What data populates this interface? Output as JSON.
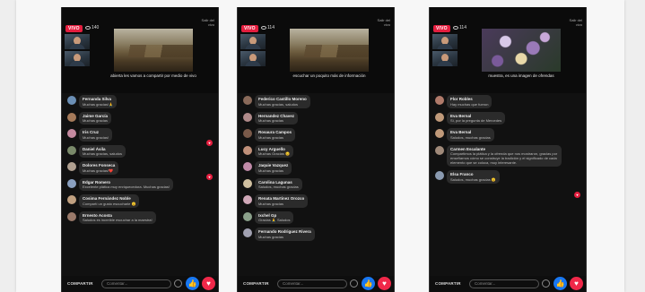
{
  "phones": [
    {
      "live": "VIVO",
      "viewers": "140",
      "close": "Salir del vivo",
      "video_style": "landscape",
      "caption": "abierta les vamos a compartir por medio de vivo",
      "share": "COMPARTIR",
      "comment_placeholder": "Comentar...",
      "comments": [
        {
          "name": "Fernanda Silva",
          "text": "Muchas gracias!🙏",
          "actions": "Me gusta · Responder",
          "avatar": "#6b8fb5"
        },
        {
          "name": "Jaime García",
          "text": "Muchas gracias",
          "actions": "Me gusta · Responder",
          "avatar": "#a57a5a"
        },
        {
          "name": "Iris Cruz",
          "text": "Muchas gracias!",
          "actions": "Me gusta · Responder",
          "avatar": "#c58aa0"
        },
        {
          "name": "Daniel Ávila",
          "text": "Muchas gracias, saludos",
          "actions": "Me gusta · Responder",
          "avatar": "#7a8a6a"
        },
        {
          "name": "Dolores Fonseca",
          "text": "Muchas gracias!❤️",
          "actions": "Me gusta · Responder",
          "avatar": "#b0a090"
        },
        {
          "name": "Edgar Romero",
          "text": "Excelente plática muy enriquecedora. Muchas gracias!",
          "actions": "Me gusta · Responder",
          "avatar": "#8aa0c0"
        },
        {
          "name": "Cosima Fernández Noble",
          "text": "Compartí un gusto escucharle 😊",
          "actions": "Me gusta · Responder",
          "avatar": "#c0a080"
        },
        {
          "name": "Ernesto Acosta",
          "text": "Saludos es increíble escuchar a la maestra!",
          "actions": "Me gusta · Responder",
          "avatar": "#9a7a6a"
        }
      ]
    },
    {
      "live": "VIVO",
      "viewers": "114",
      "close": "Salir del vivo",
      "video_style": "landscape",
      "caption": "escuchar un poquito más de información",
      "share": "COMPARTIR",
      "comment_placeholder": "Comentar...",
      "comments": [
        {
          "name": "Federico Castillo Moreno",
          "text": "Muchas gracias, saludos",
          "actions": "Me gusta · Responder",
          "avatar": "#8a6a5a"
        },
        {
          "name": "Hernandez Chavez",
          "text": "Muchas gracias",
          "actions": "Me gusta · Responder",
          "avatar": "#b08a8a"
        },
        {
          "name": "Rosaura Campos",
          "text": "Muchas gracias",
          "actions": "Me gusta · Responder",
          "avatar": "#7a5a4a"
        },
        {
          "name": "Lucy Arguello",
          "text": "Muchas Gracias 😊",
          "actions": "Me gusta · Responder",
          "avatar": "#c0907a"
        },
        {
          "name": "Jaquie Vazquez",
          "text": "Muchas gracias",
          "actions": "Me gusta · Responder",
          "avatar": "#c08aa8"
        },
        {
          "name": "Carolina Lagunas",
          "text": "Saludos, muchas gracias",
          "actions": "Me gusta · Responder",
          "avatar": "#d0c0a0"
        },
        {
          "name": "Renata Martinez Orozco",
          "text": "Muchas gracias",
          "actions": "Me gusta · Responder",
          "avatar": "#d0a8b8"
        },
        {
          "name": "Ixchel Gp",
          "text": "Gracias 🙏 Saludos",
          "actions": "Me gusta · Responder",
          "avatar": "#8aa08a"
        },
        {
          "name": "Fernando Rodriguez Rivera",
          "text": "Muchas gracias",
          "actions": "Me gusta · Responder",
          "avatar": "#a0a0b0"
        }
      ]
    },
    {
      "live": "VIVO",
      "viewers": "114",
      "close": "Salir del vivo",
      "video_style": "flowers",
      "caption": "muestra, es una imagen de ofrendas",
      "share": "COMPARTIR",
      "comment_placeholder": "Comentar...",
      "comments": [
        {
          "name": "Flor Robles",
          "text": "Hay muchas que fueron",
          "actions": "Me gusta · Responder",
          "avatar": "#b07a6a"
        },
        {
          "name": "Eva Bernal",
          "text": "Sí, por la pregunta de Mercedes",
          "actions": "Me gusta · Responder",
          "avatar": "#c09a7a"
        },
        {
          "name": "Eva Bernal",
          "text": "Saludos, muchas gracias",
          "actions": "Me gusta · Responder",
          "avatar": "#c09a7a"
        },
        {
          "name": "Carmen Escalante",
          "text": "Compartimos la plática y la ofrenda que nos mostraron, gracias por enseñarnos cómo se construye la tradición y el significado de cada elemento que se coloca, muy interesante.",
          "actions": "Me gusta · Responder",
          "avatar": "#a08a7a"
        },
        {
          "name": "Elsa Franco",
          "text": "Saludos, muchas gracias 😊",
          "actions": "Me gusta · Responder",
          "avatar": "#8a9ab0"
        }
      ]
    }
  ]
}
